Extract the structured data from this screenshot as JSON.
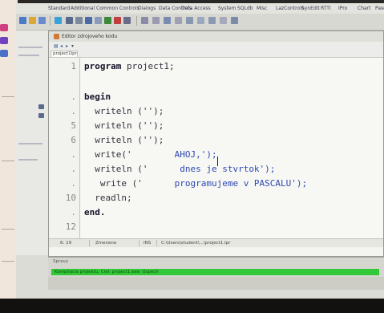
{
  "menubar": {
    "items": [
      "Standard",
      "Additional",
      "Common Controls",
      "Dialogs",
      "Data Controls",
      "Data Access",
      "System",
      "SQLdb",
      "Misc",
      "LazControls",
      "SynEdit",
      "RTTI",
      "IPro",
      "Chart",
      "Pasc"
    ]
  },
  "editor": {
    "window_title": "Editor zdrojoveho kodu",
    "tab_label": "project1lpr",
    "gutter_marks": [
      "1",
      ".",
      ".",
      "5",
      "6",
      ".",
      ".",
      ".",
      "10",
      ".",
      "12"
    ],
    "lines": [
      [
        {
          "t": "program ",
          "c": "kw"
        },
        {
          "t": "project1;",
          "c": "id"
        }
      ],
      [],
      [
        {
          "t": "begin",
          "c": "kw"
        }
      ],
      [
        {
          "t": "  writeln ('');",
          "c": "id"
        }
      ],
      [
        {
          "t": "  writeln ('');",
          "c": "id"
        }
      ],
      [
        {
          "t": "  writeln ('');",
          "c": "id"
        }
      ],
      [
        {
          "t": "  write('",
          "c": "id"
        },
        {
          "t": "        AHOJ,');",
          "c": "str"
        }
      ],
      [
        {
          "t": "  writeln ('",
          "c": "id"
        },
        {
          "t": "      dnes je stvrtok');",
          "c": "str"
        }
      ],
      [
        {
          "t": "   write ('",
          "c": "id"
        },
        {
          "t": "      programujeme v PASCALU');",
          "c": "str"
        }
      ],
      [
        {
          "t": "  readln;",
          "c": "id"
        }
      ],
      [
        {
          "t": "end.",
          "c": "kw"
        }
      ],
      []
    ]
  },
  "statusbar": {
    "position": "6: 19",
    "mode": "Zmenene",
    "insert": "INS",
    "path": "C:\\Users\\student\\...\\project1.lpr"
  },
  "messages": {
    "title": "Spravy",
    "status": "Kompilacia projektu, Ciel: project1.exe: Uspech"
  },
  "colors": {
    "success_bar": "#32c838",
    "string_literal": "#2e48b4",
    "keyword": "#141428"
  }
}
